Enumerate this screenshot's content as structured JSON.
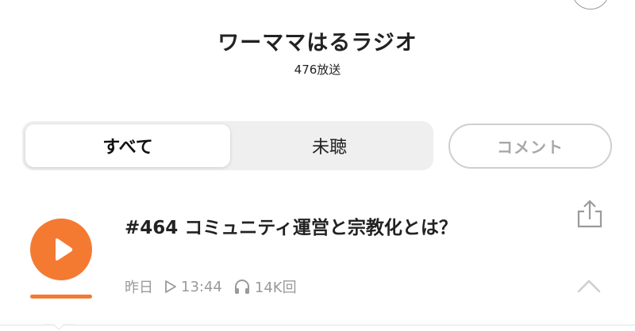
{
  "channel": {
    "title": "ワーママはるラジオ",
    "broadcast_count": "476放送"
  },
  "tabs": [
    {
      "label": "すべて",
      "active": true
    },
    {
      "label": "未聴",
      "active": false
    }
  ],
  "comment_button": {
    "label": "コメント"
  },
  "episode": {
    "title": "#464 コミュニティ運営と宗教化とは？",
    "date": "昨日",
    "duration": "13:44",
    "plays": "14K回",
    "icons": {
      "play": "play-icon",
      "duration": "play-small-icon",
      "plays": "headphones-icon",
      "share": "share-icon",
      "collapse": "chevron-up-icon"
    }
  },
  "colors": {
    "accent": "#f47a32",
    "muted_text": "#9a9a9a",
    "segment_bg": "#efefef"
  }
}
